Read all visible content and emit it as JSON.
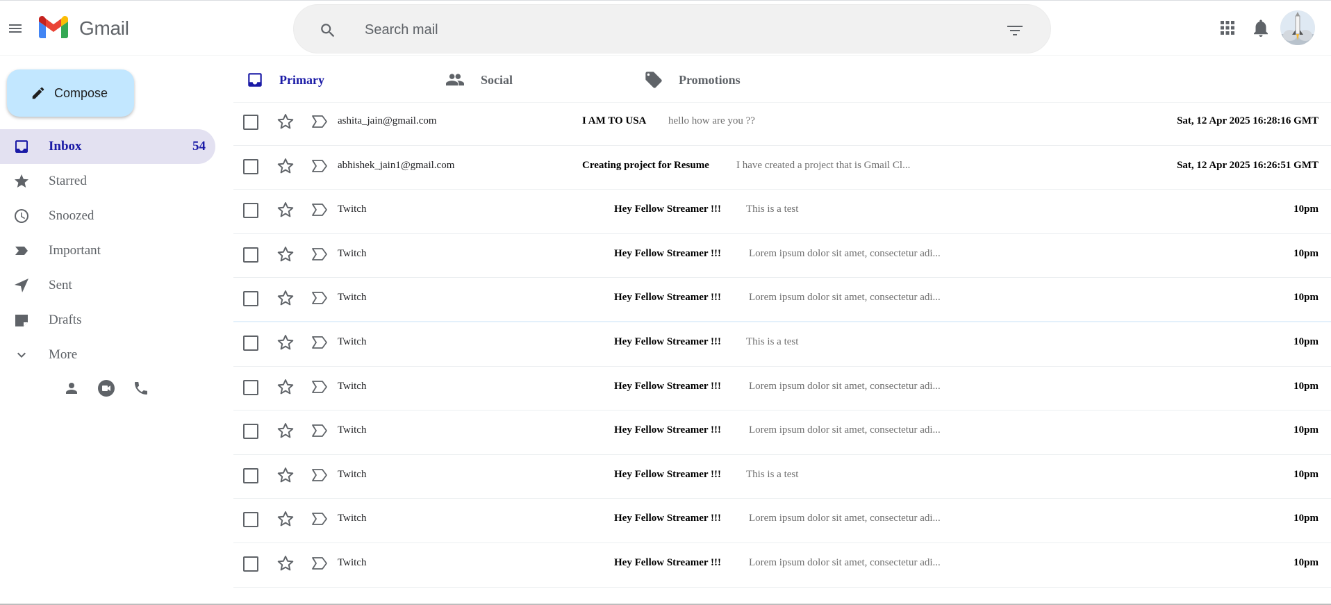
{
  "header": {
    "app_name": "Gmail",
    "search_placeholder": "Search mail"
  },
  "sidebar": {
    "compose_label": "Compose",
    "items": [
      {
        "label": "Inbox",
        "count": "54",
        "icon": "inbox-icon",
        "active": true
      },
      {
        "label": "Starred",
        "count": "",
        "icon": "star-icon"
      },
      {
        "label": "Snoozed",
        "count": "",
        "icon": "clock-icon"
      },
      {
        "label": "Important",
        "count": "",
        "icon": "important-icon"
      },
      {
        "label": "Sent",
        "count": "",
        "icon": "send-icon"
      },
      {
        "label": "Drafts",
        "count": "",
        "icon": "drafts-icon"
      },
      {
        "label": "More",
        "count": "",
        "icon": "chevron-down-icon"
      }
    ],
    "contact_icons": [
      "person-icon",
      "video-icon",
      "phone-icon"
    ]
  },
  "tabs": [
    {
      "label": "Primary",
      "icon": "inbox-icon",
      "active": true
    },
    {
      "label": "Social",
      "icon": "people-icon"
    },
    {
      "label": "Promotions",
      "icon": "tag-icon"
    }
  ],
  "emails": [
    {
      "sender": "ashita_jain@gmail.com",
      "subject": "I AM TO USA",
      "snippet": "hello how are you ??",
      "date": "Sat, 12 Apr 2025 16:28:16 GMT"
    },
    {
      "sender": "abhishek_jain1@gmail.com",
      "subject": "Creating project for Resume",
      "snippet": "I have created a project that is Gmail Cl...",
      "date": "Sat, 12 Apr 2025 16:26:51 GMT"
    },
    {
      "sender": "Twitch",
      "subject": "Hey Fellow Streamer !!!",
      "snippet": "This is a test",
      "date": "10pm"
    },
    {
      "sender": "Twitch",
      "subject": "Hey Fellow Streamer !!!",
      "snippet": "Lorem ipsum dolor sit amet, consectetur adi...",
      "date": "10pm"
    },
    {
      "sender": "Twitch",
      "subject": "Hey Fellow Streamer !!!",
      "snippet": "Lorem ipsum dolor sit amet, consectetur adi...",
      "date": "10pm"
    },
    {
      "sender": "Twitch",
      "subject": "Hey Fellow Streamer !!!",
      "snippet": "This is a test",
      "date": "10pm"
    },
    {
      "sender": "Twitch",
      "subject": "Hey Fellow Streamer !!!",
      "snippet": "Lorem ipsum dolor sit amet, consectetur adi...",
      "date": "10pm"
    },
    {
      "sender": "Twitch",
      "subject": "Hey Fellow Streamer !!!",
      "snippet": "Lorem ipsum dolor sit amet, consectetur adi...",
      "date": "10pm"
    },
    {
      "sender": "Twitch",
      "subject": "Hey Fellow Streamer !!!",
      "snippet": "This is a test",
      "date": "10pm"
    },
    {
      "sender": "Twitch",
      "subject": "Hey Fellow Streamer !!!",
      "snippet": "Lorem ipsum dolor sit amet, consectetur adi...",
      "date": "10pm"
    },
    {
      "sender": "Twitch",
      "subject": "Hey Fellow Streamer !!!",
      "snippet": "Lorem ipsum dolor sit amet, consectetur adi...",
      "date": "10pm"
    }
  ],
  "colors": {
    "accent": "#1a1aa6",
    "compose_bg": "#c2e7ff",
    "active_nav_bg": "#e3e1f1"
  }
}
